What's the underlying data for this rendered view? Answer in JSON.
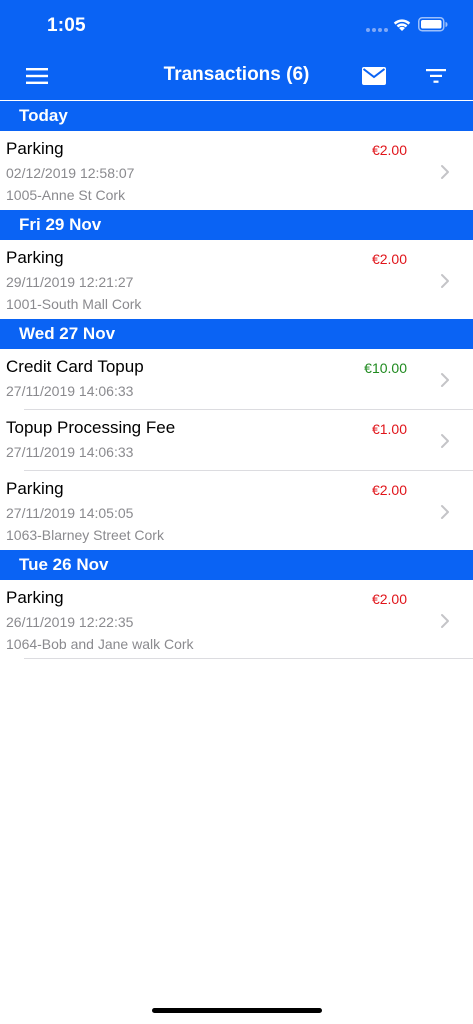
{
  "status_bar": {
    "time": "1:05"
  },
  "nav": {
    "title": "Transactions (6)",
    "icons": {
      "menu": "hamburger-menu-icon",
      "mail": "envelope-icon",
      "filter": "filter-icon"
    }
  },
  "colors": {
    "brand_blue": "#0a63f4",
    "debit_red": "#e0141a",
    "credit_green": "#1f8a1f",
    "secondary_gray": "#8a8a8e"
  },
  "sections": [
    {
      "header": "Today",
      "rows": [
        {
          "title": "Parking",
          "date": "02/12/2019 12:58:07",
          "location": "1005-Anne St Cork",
          "amount": "€2.00",
          "amount_type": "debit"
        }
      ]
    },
    {
      "header": "Fri 29 Nov",
      "rows": [
        {
          "title": "Parking",
          "date": "29/11/2019 12:21:27",
          "location": "1001-South Mall Cork",
          "amount": "€2.00",
          "amount_type": "debit"
        }
      ]
    },
    {
      "header": "Wed 27 Nov",
      "rows": [
        {
          "title": "Credit Card Topup",
          "date": "27/11/2019 14:06:33",
          "amount": "€10.00",
          "amount_type": "credit"
        },
        {
          "title": "Topup Processing Fee",
          "date": "27/11/2019 14:06:33",
          "amount": "€1.00",
          "amount_type": "debit"
        },
        {
          "title": "Parking",
          "date": "27/11/2019 14:05:05",
          "location": "1063-Blarney Street Cork",
          "amount": "€2.00",
          "amount_type": "debit"
        }
      ]
    },
    {
      "header": "Tue 26 Nov",
      "rows": [
        {
          "title": "Parking",
          "date": "26/11/2019 12:22:35",
          "location": "1064-Bob and Jane walk Cork",
          "amount": "€2.00",
          "amount_type": "debit"
        }
      ]
    }
  ]
}
